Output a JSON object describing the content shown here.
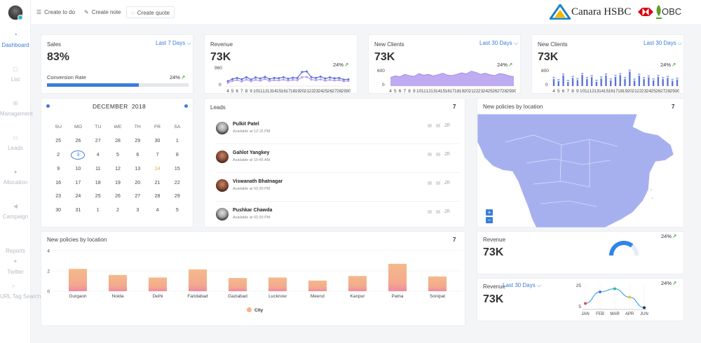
{
  "sidebar": {
    "items": [
      {
        "label": "Dashboard",
        "icon": "dashboard-icon",
        "active": true
      },
      {
        "label": "List",
        "icon": "lock-icon"
      },
      {
        "label": "Management",
        "icon": "sitemap-icon"
      },
      {
        "label": "Leads",
        "icon": "folder-icon"
      },
      {
        "label": "Allocation",
        "icon": "globe-icon"
      },
      {
        "label": "Campaign",
        "icon": "megaphone-icon"
      },
      {
        "label": "Reports",
        "icon": "reports-icon"
      },
      {
        "label": "Twitter",
        "icon": "twitter-icon"
      },
      {
        "label": "URL Tag Search",
        "icon": "search-icon"
      }
    ]
  },
  "topbar": {
    "create_todo": "Create to do",
    "create_note": "Create note",
    "create_quote": "Create quote",
    "brand_canara": "Canara HSBC",
    "brand_obc": "OBC"
  },
  "sales": {
    "title": "Sales",
    "range": "Last 7 Days",
    "value": "83%",
    "conversion_label": "Conversion Rate",
    "conversion_pct": "24%",
    "progress": 0.65
  },
  "revenue_card": {
    "title": "Revenue",
    "value": "73K",
    "pct": "24%",
    "ymax": "960",
    "ymin": "0",
    "color": "#5a6fd8"
  },
  "new_clients_area": {
    "title": "New Clients",
    "range": "Last 30 Days",
    "value": "73K",
    "pct": "24%",
    "ymax": "600",
    "ymin": "0",
    "color": "#b39cf0"
  },
  "new_clients_bars": {
    "title": "New Clients",
    "range": "Last 30 Days",
    "value": "73K",
    "pct": "24%",
    "ymax": "800",
    "ymin": "0",
    "color": "#5b73dc"
  },
  "x_ticks": [
    "4",
    "5",
    "6",
    "7",
    "8",
    "9",
    "10",
    "11",
    "12",
    "13",
    "14",
    "15",
    "16",
    "17",
    "18",
    "19",
    "20",
    "21",
    "22",
    "23",
    "24",
    "25",
    "26",
    "27",
    "28",
    "29",
    "30"
  ],
  "calendar": {
    "month": "DECEMBER",
    "year": "2018",
    "days": [
      "SU",
      "MO",
      "TU",
      "WE",
      "TH",
      "FR",
      "SA"
    ],
    "weeks": [
      [
        "25",
        "26",
        "27",
        "28",
        "29",
        "30",
        "1"
      ],
      [
        "2",
        "3",
        "4",
        "5",
        "6",
        "7",
        "8"
      ],
      [
        "9",
        "10",
        "11",
        "12",
        "13",
        "14",
        "15"
      ],
      [
        "16",
        "17",
        "18",
        "19",
        "20",
        "21",
        "22"
      ],
      [
        "23",
        "24",
        "25",
        "26",
        "27",
        "28",
        "29"
      ],
      [
        "30",
        "31",
        "1",
        "2",
        "3",
        "4",
        "5"
      ]
    ],
    "today": "3",
    "highlight": "14"
  },
  "leads": {
    "title": "Leads",
    "count": "7",
    "items": [
      {
        "name": "Pulkit Patel",
        "available": "Available at 12:15 PM",
        "time": "2h"
      },
      {
        "name": "Gahlot Yangkey",
        "available": "Available at 10:45 AM",
        "time": "2h"
      },
      {
        "name": "Viswanath Bhatnagar",
        "available": "Available at 03:30 PM",
        "time": "2h"
      },
      {
        "name": "Pushkar Chawda",
        "available": "Available at 02:30 PM",
        "time": "2h"
      }
    ]
  },
  "map_card": {
    "title": "New policies by location",
    "count": "7",
    "zoom_in": "+",
    "zoom_out": "−",
    "map_color": "#a7b0ef"
  },
  "policies_bar": {
    "title": "New policies by location",
    "count": "7",
    "legend": "City"
  },
  "revenue_gauge": {
    "title": "Revenue",
    "value": "73K",
    "pct": "24%",
    "gauge": 0.72
  },
  "revenue_line": {
    "title": "Revenue",
    "range": "Last 30 Days",
    "value": "73K",
    "pct": "24%"
  },
  "chart_data": [
    {
      "type": "line",
      "x": [
        4,
        5,
        6,
        7,
        8,
        9,
        10,
        11,
        12,
        13,
        14,
        15,
        16,
        17,
        18,
        19,
        20,
        21,
        22,
        23,
        24,
        25,
        26,
        27,
        28,
        29,
        30
      ],
      "ylim": [
        0,
        960
      ],
      "series": [
        {
          "values": [
            180,
            260,
            300,
            250,
            330,
            240,
            320,
            280,
            340,
            260,
            300,
            290,
            330,
            270,
            310,
            300,
            520,
            540,
            330,
            300,
            350,
            280,
            320,
            290,
            300,
            240,
            250
          ]
        },
        {
          "values": [
            120,
            190,
            220,
            170,
            240,
            180,
            230,
            200,
            260,
            190,
            220,
            210,
            240,
            200,
            230,
            220,
            330,
            340,
            240,
            220,
            250,
            200,
            230,
            210,
            220,
            180,
            190
          ]
        }
      ],
      "xlabel": "",
      "ylabel": ""
    },
    {
      "type": "area",
      "x": [
        4,
        5,
        6,
        7,
        8,
        9,
        10,
        11,
        12,
        13,
        14,
        15,
        16,
        17,
        18,
        19,
        20,
        21,
        22,
        23,
        24,
        25,
        26,
        27,
        28,
        29,
        30
      ],
      "ylim": [
        0,
        600
      ],
      "series": [
        {
          "values": [
            220,
            260,
            240,
            300,
            270,
            250,
            320,
            280,
            300,
            260,
            290,
            330,
            280,
            270,
            300,
            340,
            310,
            380,
            350,
            300,
            330,
            290,
            270,
            320,
            300,
            260,
            240
          ]
        }
      ]
    },
    {
      "type": "bar",
      "x": [
        4,
        5,
        6,
        7,
        8,
        9,
        10,
        11,
        12,
        13,
        14,
        15,
        16,
        17,
        18,
        19,
        20,
        21,
        22,
        23,
        24,
        25,
        26,
        27,
        28,
        29,
        30
      ],
      "ylim": [
        0,
        800
      ],
      "series": [
        {
          "values": [
            260,
            180,
            390,
            150,
            300,
            220,
            410,
            260,
            330,
            160,
            280,
            390,
            210,
            340,
            400,
            260,
            530,
            200,
            380,
            260,
            320,
            210,
            340,
            260,
            300,
            190,
            240
          ]
        }
      ]
    },
    {
      "type": "bar",
      "title": "New policies by location",
      "categories": [
        "Gurgaon",
        "Noida",
        "Delhi",
        "Faridabad",
        "Gaziabad",
        "Lucknow",
        "Meerut",
        "Kanpur",
        "Patna",
        "Sonipat"
      ],
      "series": [
        {
          "name": "City",
          "values": [
            2.2,
            1.6,
            1.35,
            2.15,
            1.3,
            1.35,
            1.05,
            1.5,
            2.7,
            1.45
          ]
        }
      ],
      "yticks": [
        "0",
        "2",
        "4"
      ],
      "ylim": [
        0,
        4
      ],
      "legend": "bottom-center"
    },
    {
      "type": "line",
      "categories": [
        "JAN",
        "FEB",
        "MAR",
        "APR",
        "JUN"
      ],
      "series": [
        {
          "values": [
            8,
            19,
            22,
            14,
            4
          ]
        }
      ],
      "yticks": [
        "5",
        "25"
      ],
      "ylim": [
        5,
        25
      ]
    }
  ]
}
